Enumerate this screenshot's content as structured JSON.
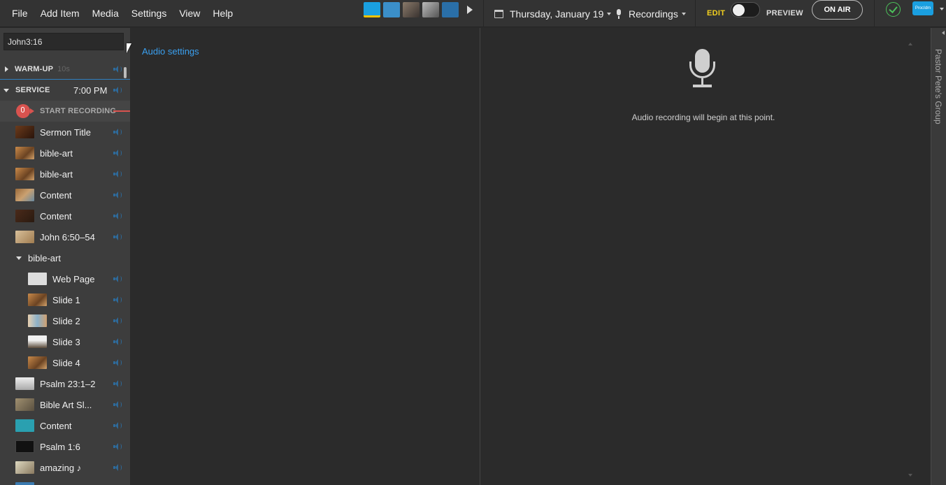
{
  "menu": {
    "items": [
      "File",
      "Add Item",
      "Media",
      "Settings",
      "View",
      "Help"
    ]
  },
  "header": {
    "date": "Thursday, January 19",
    "recordings": "Recordings",
    "edit": "EDIT",
    "preview": "PREVIEW",
    "on_air": "ON AIR",
    "org_logo_text": "ProcIdm"
  },
  "sidebar": {
    "search_value": "John3:16",
    "warmup": {
      "title": "WARM-UP",
      "length": "10s"
    },
    "service": {
      "title": "SERVICE",
      "time": "7:00 PM"
    },
    "start_recording": "START RECORDING",
    "items": [
      {
        "label": "Sermon Title"
      },
      {
        "label": "bible-art"
      },
      {
        "label": "bible-art"
      },
      {
        "label": "Content"
      },
      {
        "label": "Content"
      },
      {
        "label": "John 6:50–54"
      }
    ],
    "group": {
      "label": "bible-art",
      "children": [
        {
          "label": "Web Page"
        },
        {
          "label": "Slide 1"
        },
        {
          "label": "Slide 2"
        },
        {
          "label": "Slide 3"
        },
        {
          "label": "Slide 4"
        }
      ]
    },
    "more_items": [
      {
        "label": "Psalm 23:1–2"
      },
      {
        "label": "Bible Art  Sl..."
      },
      {
        "label": "Content"
      },
      {
        "label": "Psalm 1:6"
      },
      {
        "label": "amazing  ♪"
      }
    ]
  },
  "middle": {
    "audio_settings": "Audio settings"
  },
  "preview": {
    "message": "Audio recording will begin at this point."
  },
  "side_tab": {
    "label": "Pastor Pete's Group"
  }
}
